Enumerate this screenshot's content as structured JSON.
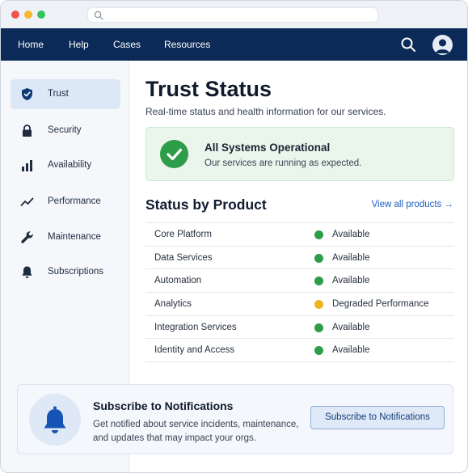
{
  "nav": {
    "links": [
      "Home",
      "Help",
      "Cases",
      "Resources"
    ]
  },
  "sidebar": {
    "items": [
      {
        "label": "Trust",
        "icon": "shield-icon",
        "active": true
      },
      {
        "label": "Security",
        "icon": "lock-icon"
      },
      {
        "label": "Availability",
        "icon": "bar-chart-icon"
      },
      {
        "label": "Performance",
        "icon": "trend-line-icon"
      },
      {
        "label": "Maintenance",
        "icon": "wrench-icon"
      },
      {
        "label": "Subscriptions",
        "icon": "bell-icon"
      }
    ]
  },
  "main": {
    "title": "Trust Status",
    "subtitle": "Real-time status and health information for our services.",
    "banner": {
      "title": "All Systems Operational",
      "description": "Our services are running as expected."
    },
    "section_title": "Status by Product",
    "view_all": "View all products →",
    "products": [
      {
        "name": "Core Platform",
        "status": "Available",
        "color": "#2e9d49"
      },
      {
        "name": "Data Services",
        "status": "Available",
        "color": "#2e9d49"
      },
      {
        "name": "Automation",
        "status": "Available",
        "color": "#2e9d49"
      },
      {
        "name": "Analytics",
        "status": "Degraded Performance",
        "color": "#f0b323"
      },
      {
        "name": "Integration Services",
        "status": "Available",
        "color": "#2e9d49"
      },
      {
        "name": "Identity and Access",
        "status": "Available",
        "color": "#2e9d49"
      }
    ]
  },
  "subscribe": {
    "title": "Subscribe to Notifications",
    "description": "Get notified about service incidents, maintenance, and updates that may impact your orgs.",
    "button": "Subscribe to Notifications"
  },
  "colors": {
    "nav_bg": "#0b2a57",
    "accent": "#1b5fbf",
    "success": "#2e9d49",
    "warning": "#f0b323"
  }
}
